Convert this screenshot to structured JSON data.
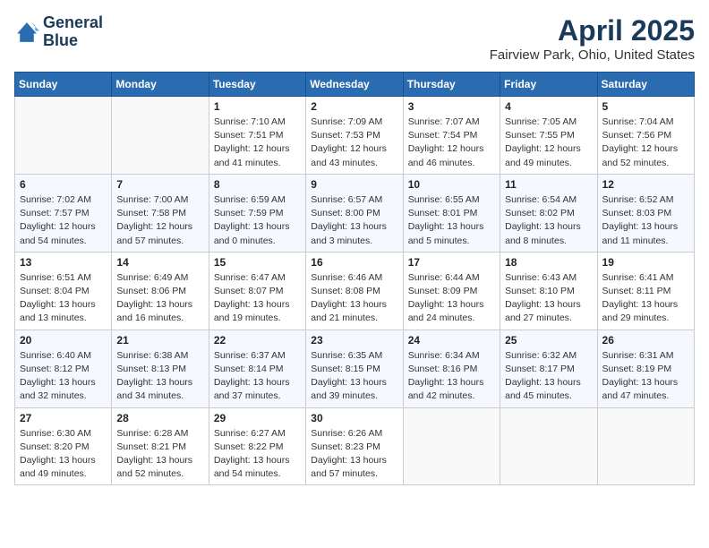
{
  "header": {
    "logo_line1": "General",
    "logo_line2": "Blue",
    "month_title": "April 2025",
    "location": "Fairview Park, Ohio, United States"
  },
  "days_of_week": [
    "Sunday",
    "Monday",
    "Tuesday",
    "Wednesday",
    "Thursday",
    "Friday",
    "Saturday"
  ],
  "weeks": [
    [
      {
        "day": "",
        "info": ""
      },
      {
        "day": "",
        "info": ""
      },
      {
        "day": "1",
        "info": "Sunrise: 7:10 AM\nSunset: 7:51 PM\nDaylight: 12 hours and 41 minutes."
      },
      {
        "day": "2",
        "info": "Sunrise: 7:09 AM\nSunset: 7:53 PM\nDaylight: 12 hours and 43 minutes."
      },
      {
        "day": "3",
        "info": "Sunrise: 7:07 AM\nSunset: 7:54 PM\nDaylight: 12 hours and 46 minutes."
      },
      {
        "day": "4",
        "info": "Sunrise: 7:05 AM\nSunset: 7:55 PM\nDaylight: 12 hours and 49 minutes."
      },
      {
        "day": "5",
        "info": "Sunrise: 7:04 AM\nSunset: 7:56 PM\nDaylight: 12 hours and 52 minutes."
      }
    ],
    [
      {
        "day": "6",
        "info": "Sunrise: 7:02 AM\nSunset: 7:57 PM\nDaylight: 12 hours and 54 minutes."
      },
      {
        "day": "7",
        "info": "Sunrise: 7:00 AM\nSunset: 7:58 PM\nDaylight: 12 hours and 57 minutes."
      },
      {
        "day": "8",
        "info": "Sunrise: 6:59 AM\nSunset: 7:59 PM\nDaylight: 13 hours and 0 minutes."
      },
      {
        "day": "9",
        "info": "Sunrise: 6:57 AM\nSunset: 8:00 PM\nDaylight: 13 hours and 3 minutes."
      },
      {
        "day": "10",
        "info": "Sunrise: 6:55 AM\nSunset: 8:01 PM\nDaylight: 13 hours and 5 minutes."
      },
      {
        "day": "11",
        "info": "Sunrise: 6:54 AM\nSunset: 8:02 PM\nDaylight: 13 hours and 8 minutes."
      },
      {
        "day": "12",
        "info": "Sunrise: 6:52 AM\nSunset: 8:03 PM\nDaylight: 13 hours and 11 minutes."
      }
    ],
    [
      {
        "day": "13",
        "info": "Sunrise: 6:51 AM\nSunset: 8:04 PM\nDaylight: 13 hours and 13 minutes."
      },
      {
        "day": "14",
        "info": "Sunrise: 6:49 AM\nSunset: 8:06 PM\nDaylight: 13 hours and 16 minutes."
      },
      {
        "day": "15",
        "info": "Sunrise: 6:47 AM\nSunset: 8:07 PM\nDaylight: 13 hours and 19 minutes."
      },
      {
        "day": "16",
        "info": "Sunrise: 6:46 AM\nSunset: 8:08 PM\nDaylight: 13 hours and 21 minutes."
      },
      {
        "day": "17",
        "info": "Sunrise: 6:44 AM\nSunset: 8:09 PM\nDaylight: 13 hours and 24 minutes."
      },
      {
        "day": "18",
        "info": "Sunrise: 6:43 AM\nSunset: 8:10 PM\nDaylight: 13 hours and 27 minutes."
      },
      {
        "day": "19",
        "info": "Sunrise: 6:41 AM\nSunset: 8:11 PM\nDaylight: 13 hours and 29 minutes."
      }
    ],
    [
      {
        "day": "20",
        "info": "Sunrise: 6:40 AM\nSunset: 8:12 PM\nDaylight: 13 hours and 32 minutes."
      },
      {
        "day": "21",
        "info": "Sunrise: 6:38 AM\nSunset: 8:13 PM\nDaylight: 13 hours and 34 minutes."
      },
      {
        "day": "22",
        "info": "Sunrise: 6:37 AM\nSunset: 8:14 PM\nDaylight: 13 hours and 37 minutes."
      },
      {
        "day": "23",
        "info": "Sunrise: 6:35 AM\nSunset: 8:15 PM\nDaylight: 13 hours and 39 minutes."
      },
      {
        "day": "24",
        "info": "Sunrise: 6:34 AM\nSunset: 8:16 PM\nDaylight: 13 hours and 42 minutes."
      },
      {
        "day": "25",
        "info": "Sunrise: 6:32 AM\nSunset: 8:17 PM\nDaylight: 13 hours and 45 minutes."
      },
      {
        "day": "26",
        "info": "Sunrise: 6:31 AM\nSunset: 8:19 PM\nDaylight: 13 hours and 47 minutes."
      }
    ],
    [
      {
        "day": "27",
        "info": "Sunrise: 6:30 AM\nSunset: 8:20 PM\nDaylight: 13 hours and 49 minutes."
      },
      {
        "day": "28",
        "info": "Sunrise: 6:28 AM\nSunset: 8:21 PM\nDaylight: 13 hours and 52 minutes."
      },
      {
        "day": "29",
        "info": "Sunrise: 6:27 AM\nSunset: 8:22 PM\nDaylight: 13 hours and 54 minutes."
      },
      {
        "day": "30",
        "info": "Sunrise: 6:26 AM\nSunset: 8:23 PM\nDaylight: 13 hours and 57 minutes."
      },
      {
        "day": "",
        "info": ""
      },
      {
        "day": "",
        "info": ""
      },
      {
        "day": "",
        "info": ""
      }
    ]
  ]
}
